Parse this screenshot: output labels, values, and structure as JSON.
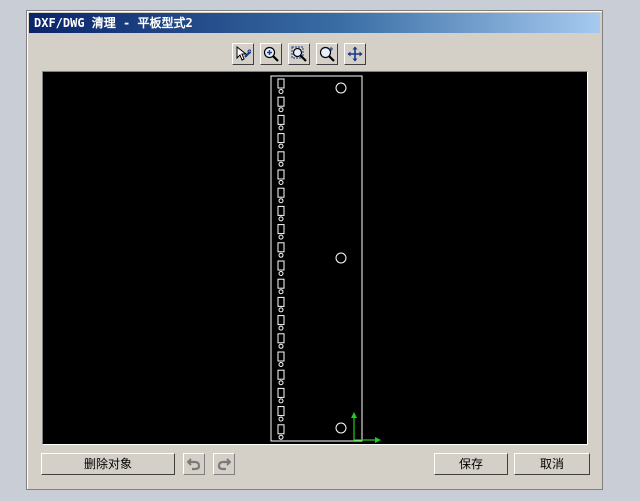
{
  "window": {
    "title": "DXF/DWG 清理 - 平板型式2"
  },
  "toolbar": {
    "tools": [
      {
        "name": "select-tool",
        "icon": "cursor-wrench-icon"
      },
      {
        "name": "zoom-in",
        "icon": "zoom-in-icon"
      },
      {
        "name": "zoom-fit",
        "icon": "zoom-fit-icon"
      },
      {
        "name": "zoom-area",
        "icon": "zoom-area-icon"
      },
      {
        "name": "pan",
        "icon": "pan-move-icon"
      }
    ]
  },
  "footer": {
    "delete_label": "删除对象",
    "undo_icon": "undo-icon",
    "redo_icon": "redo-icon",
    "save_label": "保存",
    "cancel_label": "取消"
  },
  "colors": {
    "canvas_bg": "#000000",
    "drawing_stroke": "#ffffff",
    "axis_y": "#22cc22",
    "axis_x": "#22cc22",
    "title_gradient_start": "#0a246a",
    "title_gradient_end": "#a6caf0"
  }
}
